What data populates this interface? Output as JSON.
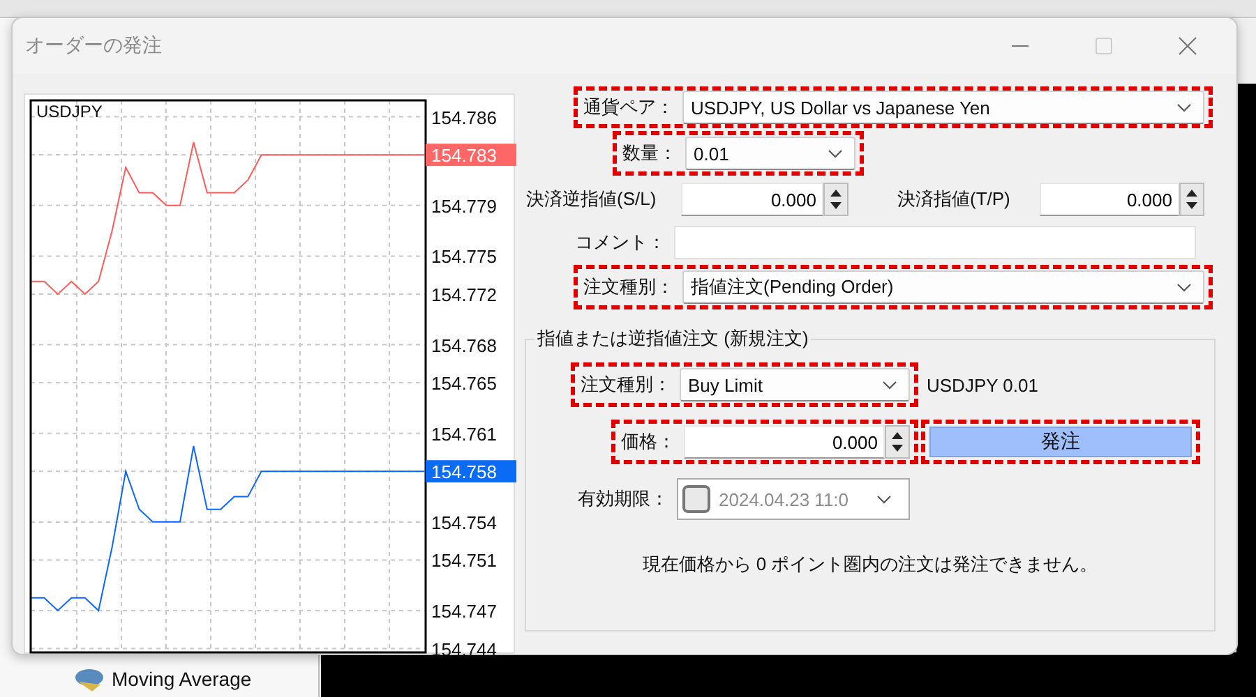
{
  "window": {
    "title": "オーダーの発注",
    "active": false
  },
  "chart": {
    "symbol": "USDJPY",
    "price_labels": [
      {
        "text": "154.783",
        "color": "#ff6666"
      },
      {
        "text": "154.758",
        "color": "#0a6cf5"
      }
    ],
    "chart_data": {
      "type": "line",
      "grid": true,
      "series": [
        {
          "color": "#ff5a5a",
          "values": [
            154.773,
            154.773,
            154.772,
            154.773,
            154.772,
            154.773,
            154.777,
            154.782,
            154.78,
            154.78,
            154.779,
            154.779,
            154.784,
            154.78,
            154.78,
            154.78,
            154.781,
            154.783,
            154.783,
            154.783,
            154.783,
            154.783,
            154.783,
            154.783,
            154.783,
            154.783,
            154.783,
            154.783,
            154.783,
            154.783
          ]
        },
        {
          "color": "#0a66ff",
          "values": [
            154.748,
            154.748,
            154.747,
            154.748,
            154.748,
            154.747,
            154.752,
            154.758,
            154.755,
            154.754,
            154.754,
            154.754,
            154.76,
            154.755,
            154.755,
            154.756,
            154.756,
            154.758,
            154.758,
            154.758,
            154.758,
            154.758,
            154.758,
            154.758,
            154.758,
            154.758,
            154.758,
            154.758,
            154.758,
            154.758
          ]
        }
      ],
      "ylim": [
        154.7437,
        154.7873
      ],
      "yticks": [
        154.786,
        154.779,
        154.775,
        154.772,
        154.768,
        154.765,
        154.761,
        154.754,
        154.751,
        154.747,
        154.744
      ]
    }
  },
  "form": {
    "rows": [
      {
        "kind": "select",
        "label": "通貨ペア：",
        "value": "USDJPY, US Dollar vs Japanese Yen",
        "highlighted": true
      },
      {
        "kind": "select",
        "label": "数量：",
        "value": "0.01",
        "highlighted": true
      },
      {
        "kind": "pair",
        "fields": [
          {
            "label": "決済逆指値(S/L)",
            "value": "0.000"
          },
          {
            "label": "決済指値(T/P)",
            "value": "0.000"
          }
        ]
      },
      {
        "kind": "text",
        "label": "コメント：",
        "highlighted": false
      },
      {
        "kind": "select",
        "label": "注文種別：",
        "value": "指値注文(Pending Order)",
        "highlighted": true
      }
    ]
  },
  "pending_group": {
    "title": "指値または逆指値注文 (新規注文)",
    "order_type": {
      "label": "注文種別：",
      "value": "Buy Limit",
      "highlighted": true
    },
    "summary": "USDJPY 0.01",
    "price": {
      "label": "価格：",
      "value": "0.000",
      "highlighted": true
    },
    "place_button": {
      "label": "発注",
      "highlighted": true
    },
    "expiry": {
      "label": "有効期限：",
      "checked": false,
      "value": "2024.04.23 11:0"
    },
    "note": "現在価格から 0 ポイント圏内の注文は発注できません。"
  },
  "background": {
    "navigator_item": "Moving Average"
  }
}
